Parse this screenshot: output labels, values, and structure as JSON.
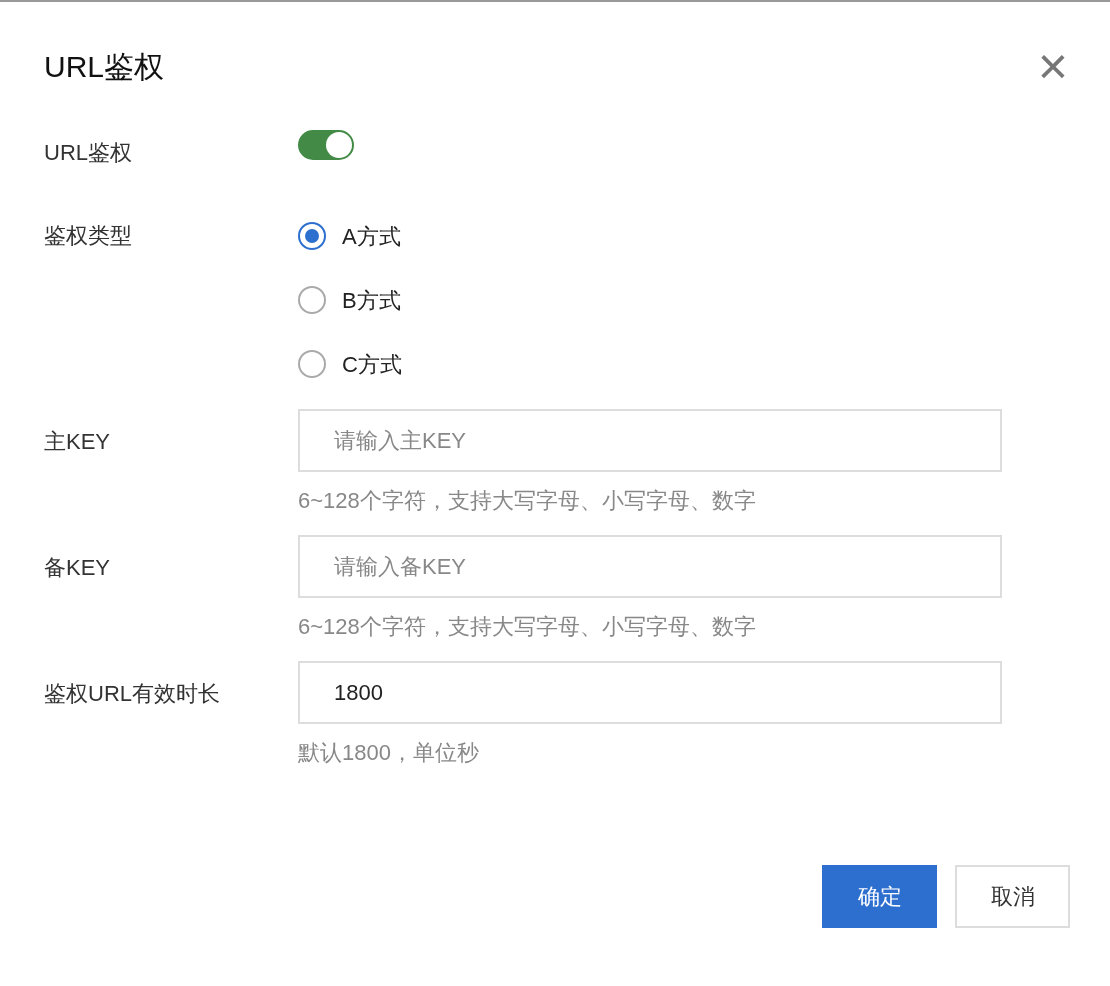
{
  "dialog": {
    "title": "URL鉴权",
    "close_icon": "×"
  },
  "rows": [
    {
      "kind": "switch",
      "label": "URL鉴权",
      "on": true
    },
    {
      "kind": "radio",
      "label": "鉴权类型",
      "options": [
        {
          "label": "A方式",
          "selected": true
        },
        {
          "label": "B方式",
          "selected": false
        },
        {
          "label": "C方式",
          "selected": false
        }
      ]
    },
    {
      "kind": "input",
      "label": "主KEY",
      "placeholder": "请输入主KEY",
      "help": "6~128个字符，支持大写字母、小写字母、数字"
    },
    {
      "kind": "input",
      "label": "备KEY",
      "placeholder": "请输入备KEY",
      "help": "6~128个字符，支持大写字母、小写字母、数字"
    },
    {
      "kind": "input",
      "label": "鉴权URL有效时长",
      "value": "1800",
      "help": "默认1800，单位秒"
    }
  ],
  "buttons": [
    {
      "label": "确定",
      "kind": "primary"
    },
    {
      "label": "取消",
      "kind": "secondary"
    }
  ]
}
